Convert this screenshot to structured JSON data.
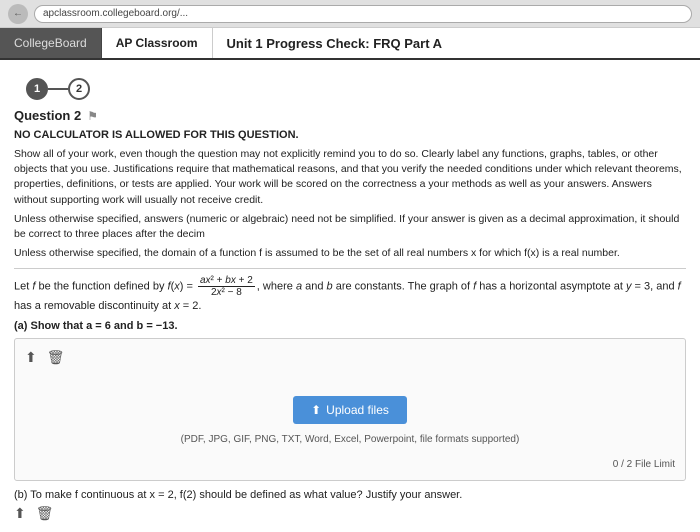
{
  "browser": {
    "url": "apclassroom.collegeboard.org/..."
  },
  "nav": {
    "tab1_label": "CollegeBoard",
    "tab2_label": "AP Classroom",
    "page_title": "Unit 1 Progress Check: FRQ Part A"
  },
  "steps": {
    "step1_label": "1",
    "step2_label": "2"
  },
  "question": {
    "title": "Question 2",
    "no_calc": "NO CALCULATOR IS ALLOWED FOR THIS QUESTION.",
    "instructions1": "Show all of your work, even though the question may not explicitly remind you to do so. Clearly label any functions, graphs, tables, or other objects that you use. Justifications require that mathematical reasons, and that you verify the needed conditions under which relevant theorems, properties, definitions, or tests are applied. Your work will be scored on the correctness a your methods as well as your answers. Answers without supporting work will usually not receive credit.",
    "instructions2": "Unless otherwise specified, answers (numeric or algebraic) need not be simplified. If your answer is given as a decimal approximation, it should be correct to three places after the decim",
    "instructions3": "Unless otherwise specified, the domain of a function f is assumed to be the set of all real numbers x for which f(x) is a real number.",
    "function_def": "Let f be the function defined by f(x) = (ax² + bx + 2) / (2x² - 8), where a and b are constants. The graph of f has a horizontal asymptote at y = 3, and f has a removable discontinuity at x = 2.",
    "part_a_label": "(a) Show that a = 6 and b = −13.",
    "upload_btn_label": "Upload files",
    "upload_formats": "(PDF, JPG, GIF, PNG, TXT, Word, Excel, Powerpoint, file formats supported)",
    "file_limit": "0 / 2 File Limit",
    "part_b_label": "(b) To make f continuous at x = 2, f(2) should be defined as what value? Justify your answer."
  },
  "icons": {
    "upload_arrow": "⬆",
    "flag": "⚑",
    "upload_icon": "⬆",
    "trash_icon": "🗑"
  }
}
